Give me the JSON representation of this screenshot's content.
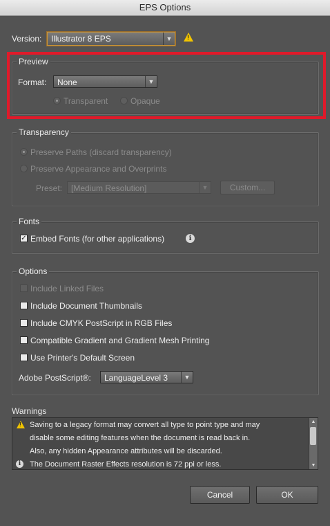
{
  "window": {
    "title": "EPS Options"
  },
  "version": {
    "label": "Version:",
    "value": "Illustrator 8 EPS",
    "warning_icon": "warning-icon"
  },
  "preview": {
    "title": "Preview",
    "format_label": "Format:",
    "format_value": "None",
    "transparent_label": "Transparent",
    "opaque_label": "Opaque"
  },
  "transparency": {
    "title": "Transparency",
    "preserve_paths": "Preserve Paths (discard transparency)",
    "preserve_appearance": "Preserve Appearance and Overprints",
    "preset_label": "Preset:",
    "preset_value": "[Medium Resolution]",
    "custom_button": "Custom..."
  },
  "fonts": {
    "title": "Fonts",
    "embed_fonts": "Embed Fonts (for other applications)"
  },
  "options": {
    "title": "Options",
    "include_linked": "Include Linked Files",
    "include_thumbnails": "Include Document Thumbnails",
    "include_cmyk": "Include CMYK PostScript in RGB Files",
    "compatible_gradient": "Compatible Gradient and Gradient Mesh Printing",
    "printer_screen": "Use Printer's Default Screen",
    "postscript_label": "Adobe PostScript®:",
    "postscript_value": "LanguageLevel 3"
  },
  "warnings": {
    "title": "Warnings",
    "line1": "Saving to a legacy format may convert all type to point type and may",
    "line2": "disable some editing features when the document is read back in.",
    "line3": "Also, any hidden Appearance attributes will be discarded.",
    "line4": "The Document Raster Effects resolution is 72 ppi or less."
  },
  "buttons": {
    "cancel": "Cancel",
    "ok": "OK"
  },
  "colors": {
    "highlight": "#e01a2a",
    "warning": "#f2c500",
    "background": "#535353"
  }
}
